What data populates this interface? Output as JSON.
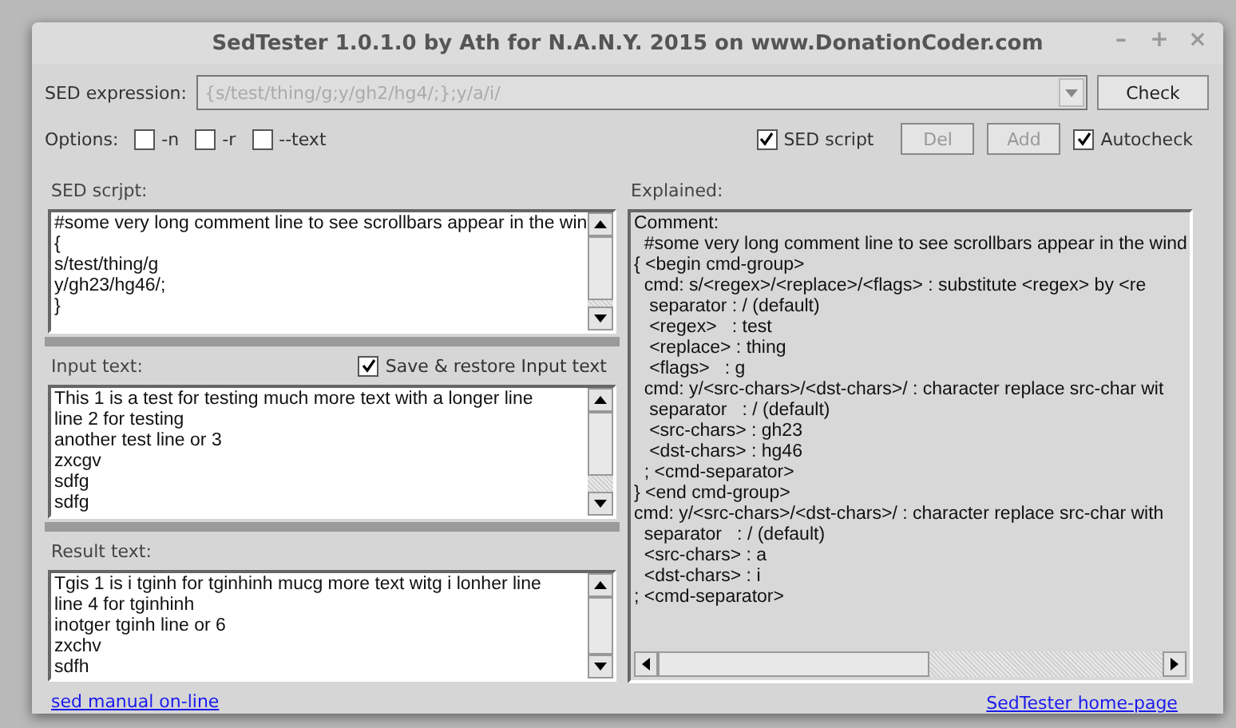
{
  "window": {
    "title": "SedTester 1.0.1.0 by Ath for N.A.N.Y. 2015 on www.DonationCoder.com",
    "controls": [
      "–",
      "+",
      "×"
    ]
  },
  "expression": {
    "label": "SED expression:",
    "value": "{s/test/thing/g;y/gh2/hg4/;};y/a/i/",
    "disabled": true,
    "button": "Check"
  },
  "options": {
    "label": "Options:",
    "items": [
      {
        "label": "-n",
        "checked": false
      },
      {
        "label": "-r",
        "checked": false
      },
      {
        "label": "--text",
        "checked": false
      }
    ],
    "sed_script": {
      "label": "SED script",
      "checked": true
    },
    "buttons": [
      {
        "label": "Del",
        "disabled": true
      },
      {
        "label": "Add",
        "disabled": true
      }
    ],
    "autocheck": {
      "label": "Autocheck",
      "checked": true
    }
  },
  "script_panel": {
    "label": "SED scrjpt:",
    "lines": [
      "#some very long comment line to see scrollbars appear in the win",
      "{",
      "s/test/thing/g",
      "y/gh23/hg46/;",
      "}"
    ]
  },
  "input_panel": {
    "label": "Input text:",
    "save": {
      "label": "Save & restore Input text",
      "checked": true
    },
    "lines": [
      "This 1 is a test for testing much more text with a longer line",
      "line 2 for testing",
      "another test line or 3",
      "zxcgv",
      "sdfg",
      "sdfg"
    ]
  },
  "result_panel": {
    "label": "Result text:",
    "lines": [
      "Tgis 1 is i tginh for tginhinh mucg more text witg i lonher line",
      "line 4 for tginhinh",
      "inotger tginh line or 6",
      "zxchv",
      "sdfh"
    ]
  },
  "explained_panel": {
    "label": "Explained:",
    "lines": [
      "Comment:",
      "  #some very long comment line to see scrollbars appear in the wind",
      "{ <begin cmd-group>",
      "  cmd: s/<regex>/<replace>/<flags> : substitute <regex> by <re",
      "   separator : / (default)",
      "   <regex>   : test",
      "   <replace> : thing",
      "   <flags>   : g",
      "  cmd: y/<src-chars>/<dst-chars>/ : character replace src-char wit",
      "   separator   : / (default)",
      "   <src-chars> : gh23",
      "   <dst-chars> : hg46",
      "  ; <cmd-separator>",
      "} <end cmd-group>",
      "cmd: y/<src-chars>/<dst-chars>/ : character replace src-char with",
      "  separator   : / (default)",
      "  <src-chars> : a",
      "  <dst-chars> : i",
      "; <cmd-separator>"
    ]
  },
  "links": [
    "sed manual on-line",
    "SedTester home-page"
  ]
}
